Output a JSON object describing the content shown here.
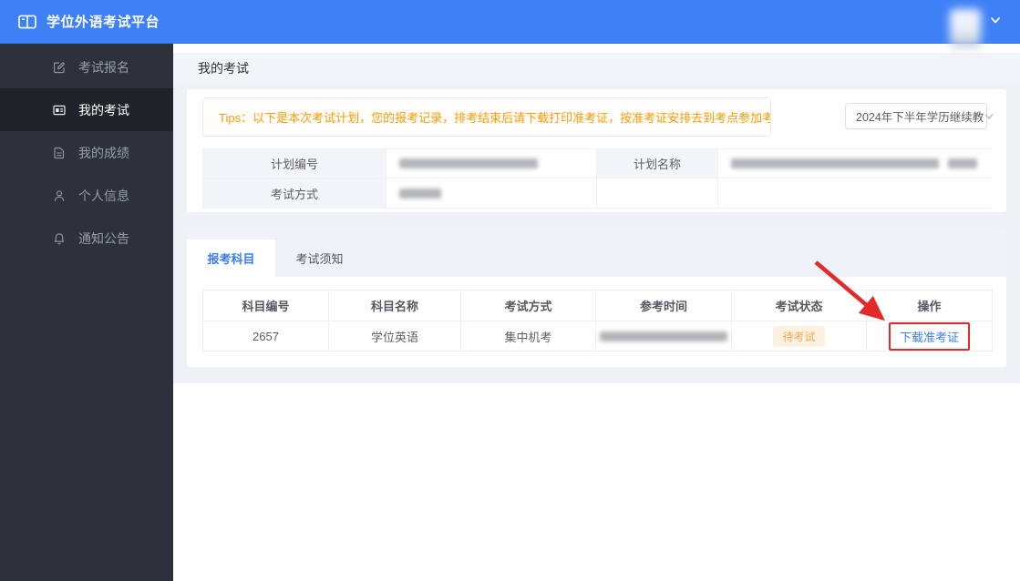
{
  "app": {
    "title": "学位外语考试平台"
  },
  "colors": {
    "primary_blue": "#3e80f6",
    "link_blue": "#3a7cf6",
    "tips_orange": "#ff9900",
    "status_badge_bg": "#fcf2e2",
    "status_badge_text": "#f0a850",
    "annotation_red": "#e12b2b",
    "sidebar_bg": "#2d3139",
    "sidebar_active_bg": "#1f242b"
  },
  "topbar": {
    "title": "学位外语考试平台"
  },
  "sidebar": {
    "items": [
      {
        "label": "考试报名",
        "icon": "edit-icon",
        "active": false
      },
      {
        "label": "我的考试",
        "icon": "exam-card-icon",
        "active": true
      },
      {
        "label": "我的成绩",
        "icon": "document-icon",
        "active": false
      },
      {
        "label": "个人信息",
        "icon": "user-icon",
        "active": false
      },
      {
        "label": "通知公告",
        "icon": "bell-icon",
        "active": false
      }
    ]
  },
  "page": {
    "title": "我的考试"
  },
  "main": {
    "tips": {
      "text": "Tips：以下是本次考试计划，您的报考记录，排考结束后请下载打印准考证，按准考证安排去到考点参加考试即可。"
    },
    "plan_select": {
      "value": "2024年下半年学历继续教"
    },
    "plan_info": {
      "fields": [
        {
          "label": "计划编号",
          "value_redacted": true
        },
        {
          "label": "计划名称",
          "value_redacted": true
        },
        {
          "label": "考试方式",
          "value_redacted": true
        }
      ]
    },
    "tabs": [
      {
        "label": "报考科目",
        "active": true
      },
      {
        "label": "考试须知",
        "active": false
      }
    ],
    "table": {
      "columns": [
        "科目编号",
        "科目名称",
        "考试方式",
        "参考时间",
        "考试状态",
        "操作"
      ],
      "rows": [
        {
          "code": "2657",
          "name": "学位英语",
          "method": "集中机考",
          "time_redacted": true,
          "status": "待考试",
          "action": "下载准考证"
        }
      ]
    },
    "annotation": {
      "type": "red-arrow-and-box",
      "target": "下载准考证"
    }
  }
}
